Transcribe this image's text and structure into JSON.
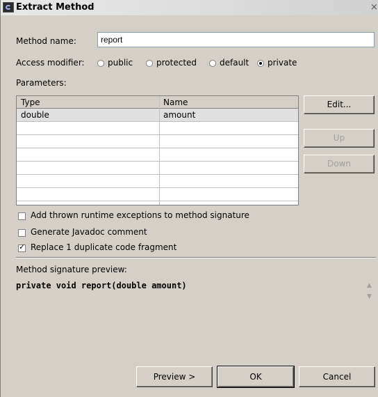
{
  "window": {
    "title": "Extract Method",
    "close_glyph": "×"
  },
  "method_name": {
    "label": "Method name:",
    "value": "report"
  },
  "access_modifier": {
    "label": "Access modifier:",
    "options": [
      "public",
      "protected",
      "default",
      "private"
    ],
    "selected": "private"
  },
  "parameters": {
    "label": "Parameters:",
    "columns": [
      "Type",
      "Name"
    ],
    "rows": [
      {
        "type": "double",
        "name": "amount"
      }
    ],
    "buttons": {
      "edit": "Edit...",
      "up": "Up",
      "down": "Down"
    }
  },
  "options": [
    {
      "label": "Add thrown runtime exceptions to method signature",
      "checked": false
    },
    {
      "label": "Generate Javadoc comment",
      "checked": false
    },
    {
      "label": "Replace 1 duplicate code fragment",
      "checked": true
    }
  ],
  "preview": {
    "label": "Method signature preview:",
    "signature": "private void report(double amount)"
  },
  "footer": {
    "preview": "Preview >",
    "ok": "OK",
    "cancel": "Cancel"
  },
  "icons": {
    "title": "eclipse-icon",
    "scroll_up": "scroll-up-icon",
    "scroll_down": "scroll-down-icon"
  },
  "colors": {
    "dialog_bg": "#d4d0c8",
    "field_border": "#7f9db9",
    "disabled_text": "#a0a0a0"
  }
}
